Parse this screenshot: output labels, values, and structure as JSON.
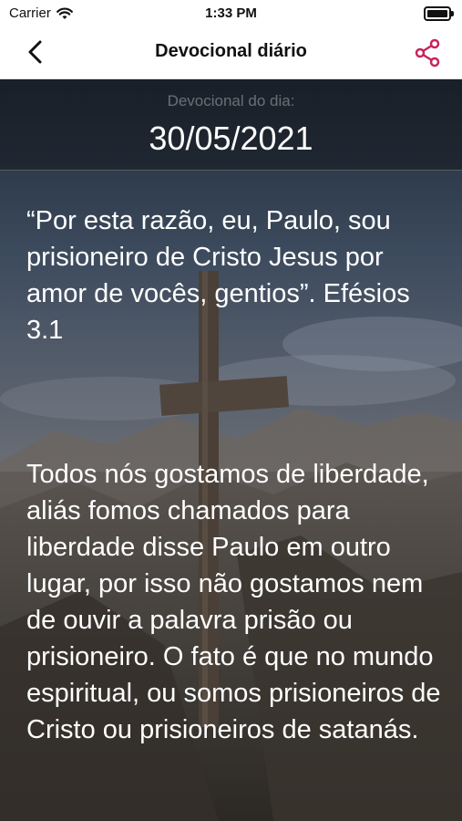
{
  "status_bar": {
    "carrier": "Carrier",
    "time": "1:33 PM"
  },
  "nav": {
    "title": "Devocional diário",
    "back_icon": "chevron-left-icon",
    "share_icon": "share-icon",
    "accent_color": "#c8245a"
  },
  "devotional": {
    "date_label": "Devocional do dia:",
    "date": "30/05/2021",
    "verse": "“Por esta razão, eu, Paulo, sou prisioneiro de Cristo Jesus por amor de vocês, gentios”. Efésios 3.1",
    "body": "Todos nós gostamos de liberdade, aliás fomos chamados para liberdade disse Paulo em outro lugar, por isso não gostamos nem de ouvir a palavra prisão ou prisioneiro. O fato é que no mundo espiritual, ou somos prisioneiros de Cristo ou prisioneiros de satanás."
  }
}
